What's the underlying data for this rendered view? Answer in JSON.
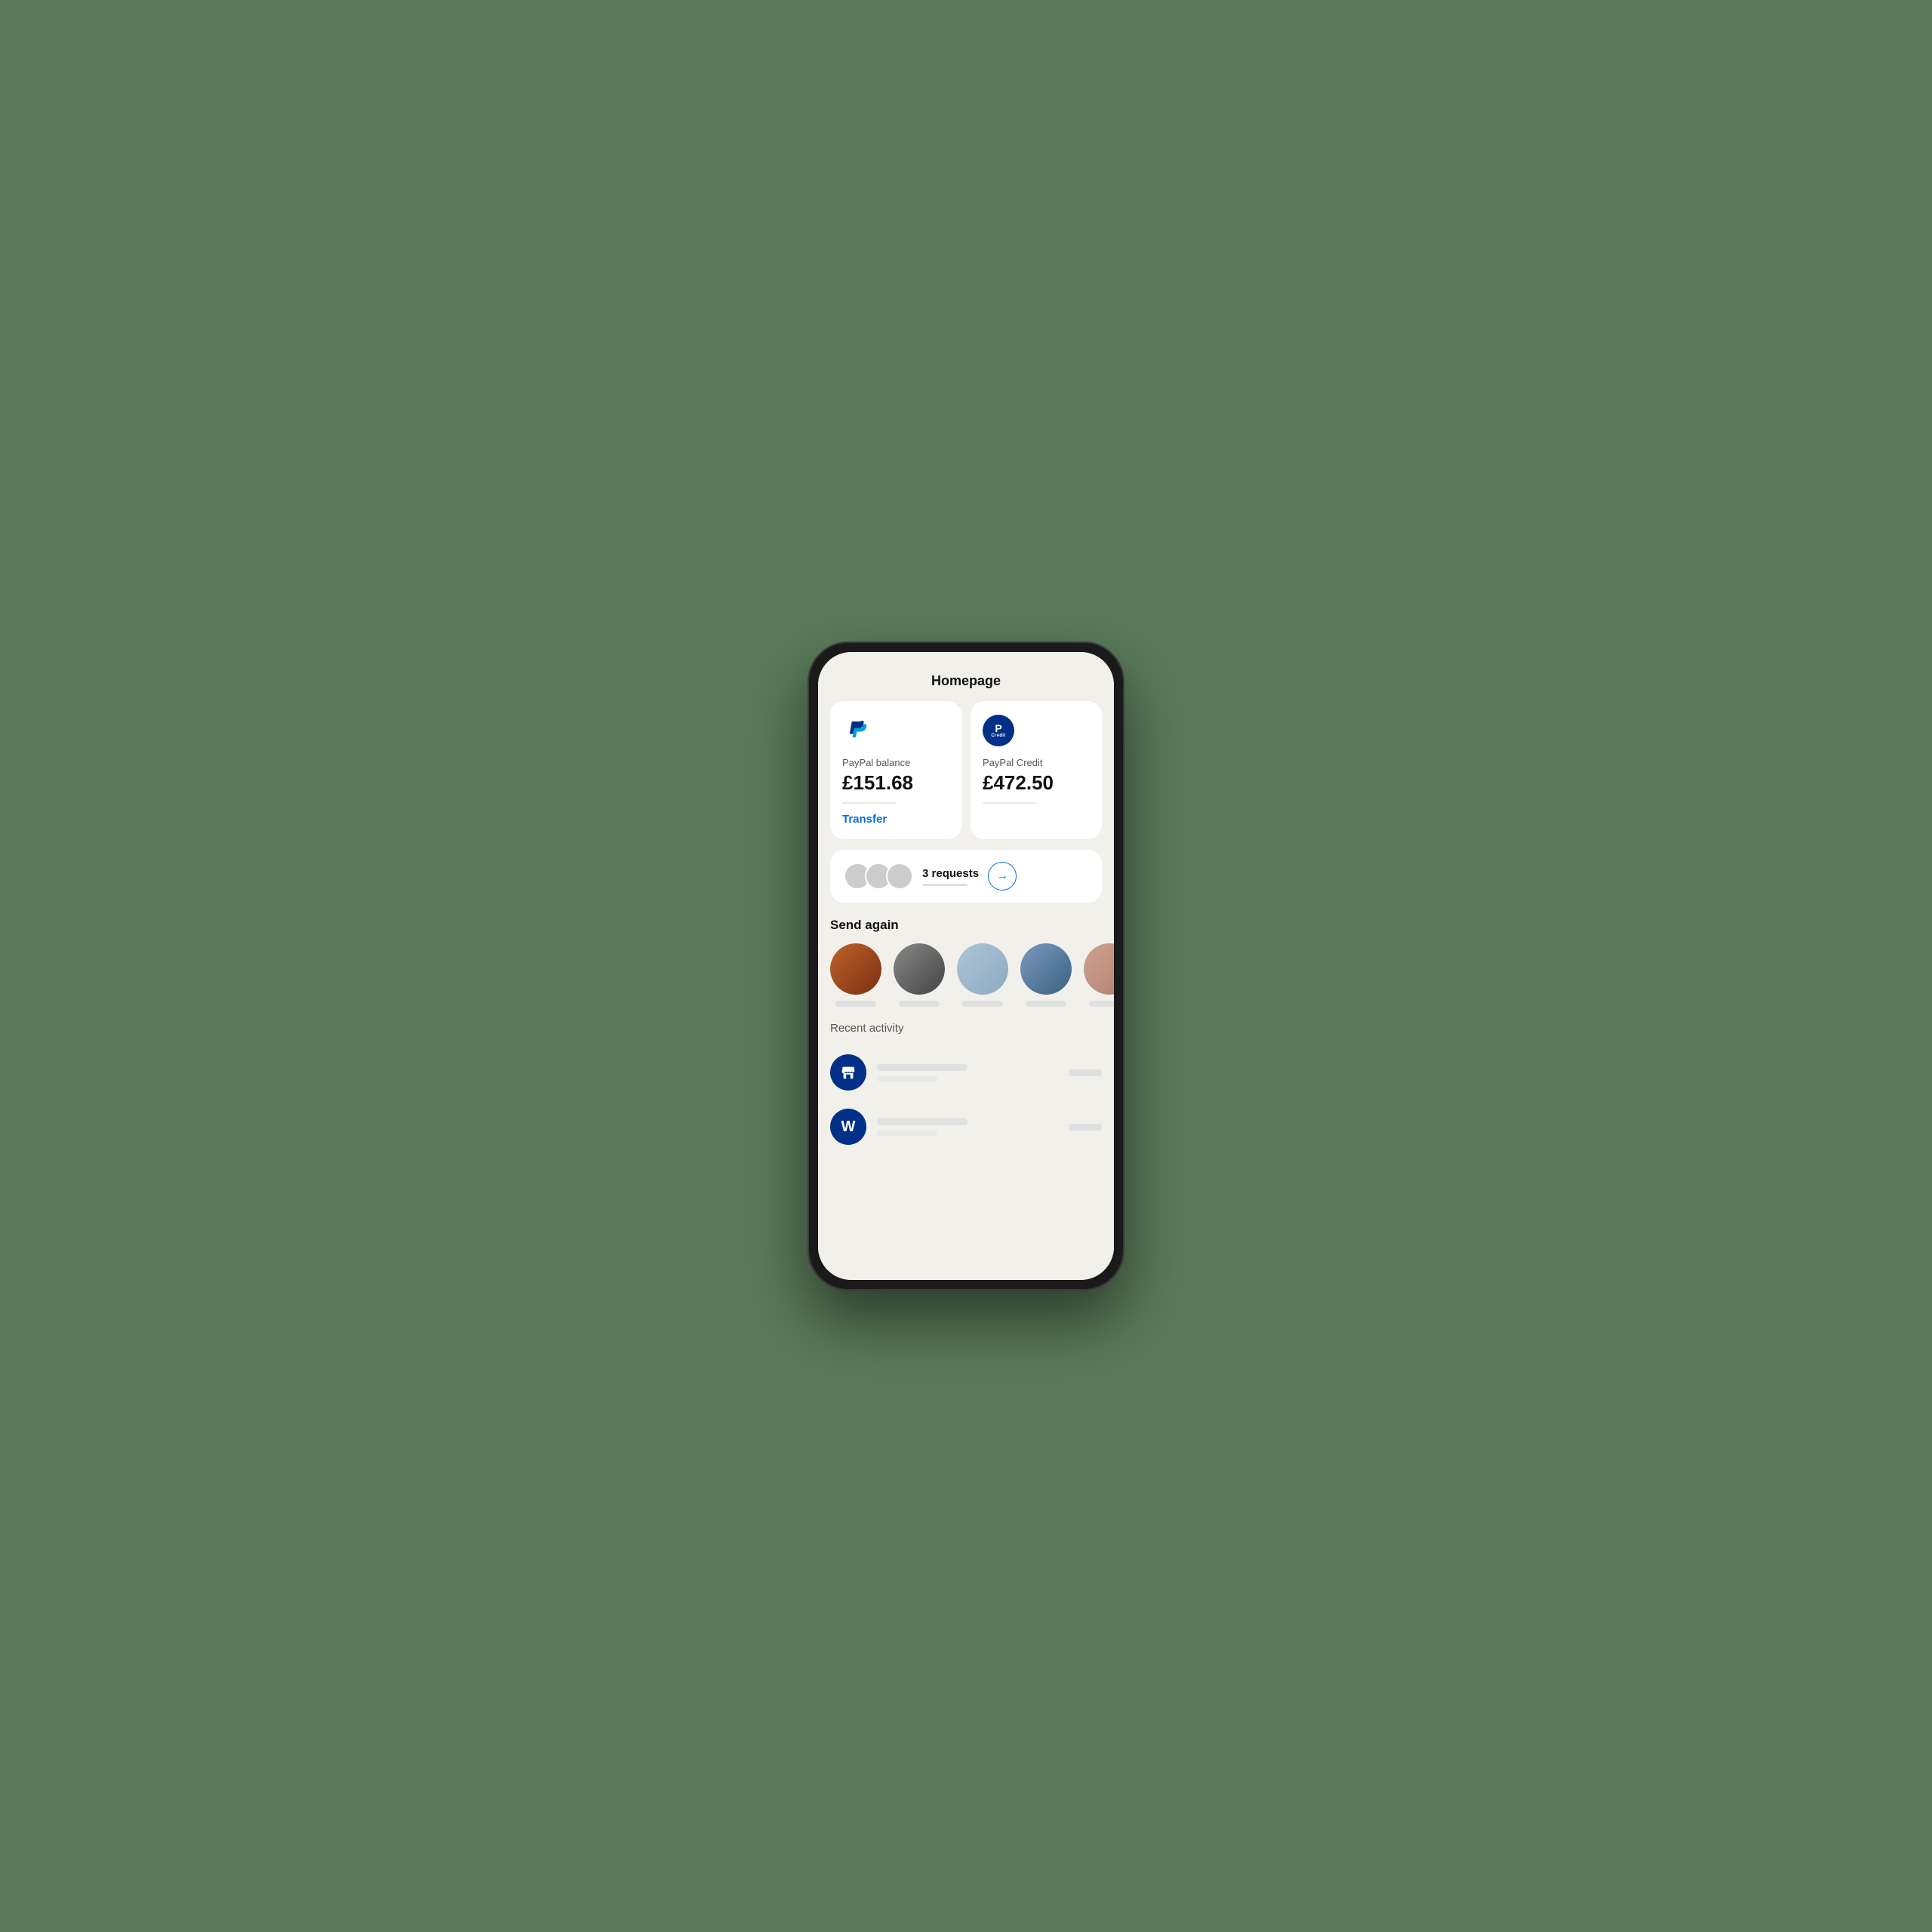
{
  "page": {
    "title": "Homepage",
    "background": "#f2f0eb"
  },
  "balance_card": {
    "label": "PayPal balance",
    "amount": "£151.68",
    "transfer_label": "Transfer"
  },
  "credit_card": {
    "label": "PayPal Credit",
    "amount": "£472.50",
    "logo_p": "P",
    "logo_credit": "Credit"
  },
  "requests": {
    "count": "3 requests",
    "arrow": "→"
  },
  "send_again": {
    "section_title": "Send again",
    "people": [
      {
        "id": "person-1",
        "face_class": "face-1"
      },
      {
        "id": "person-2",
        "face_class": "face-2"
      },
      {
        "id": "person-3",
        "face_class": "face-3"
      },
      {
        "id": "person-4",
        "face_class": "face-4"
      },
      {
        "id": "person-5",
        "face_class": "face-5"
      }
    ]
  },
  "recent_activity": {
    "section_label": "Recent activity",
    "items": [
      {
        "id": "activity-1",
        "icon_type": "store",
        "letter": ""
      },
      {
        "id": "activity-2",
        "icon_type": "letter",
        "letter": "W"
      }
    ]
  },
  "paypal_logo_color": "#009cde",
  "paypal_dark_blue": "#003087"
}
